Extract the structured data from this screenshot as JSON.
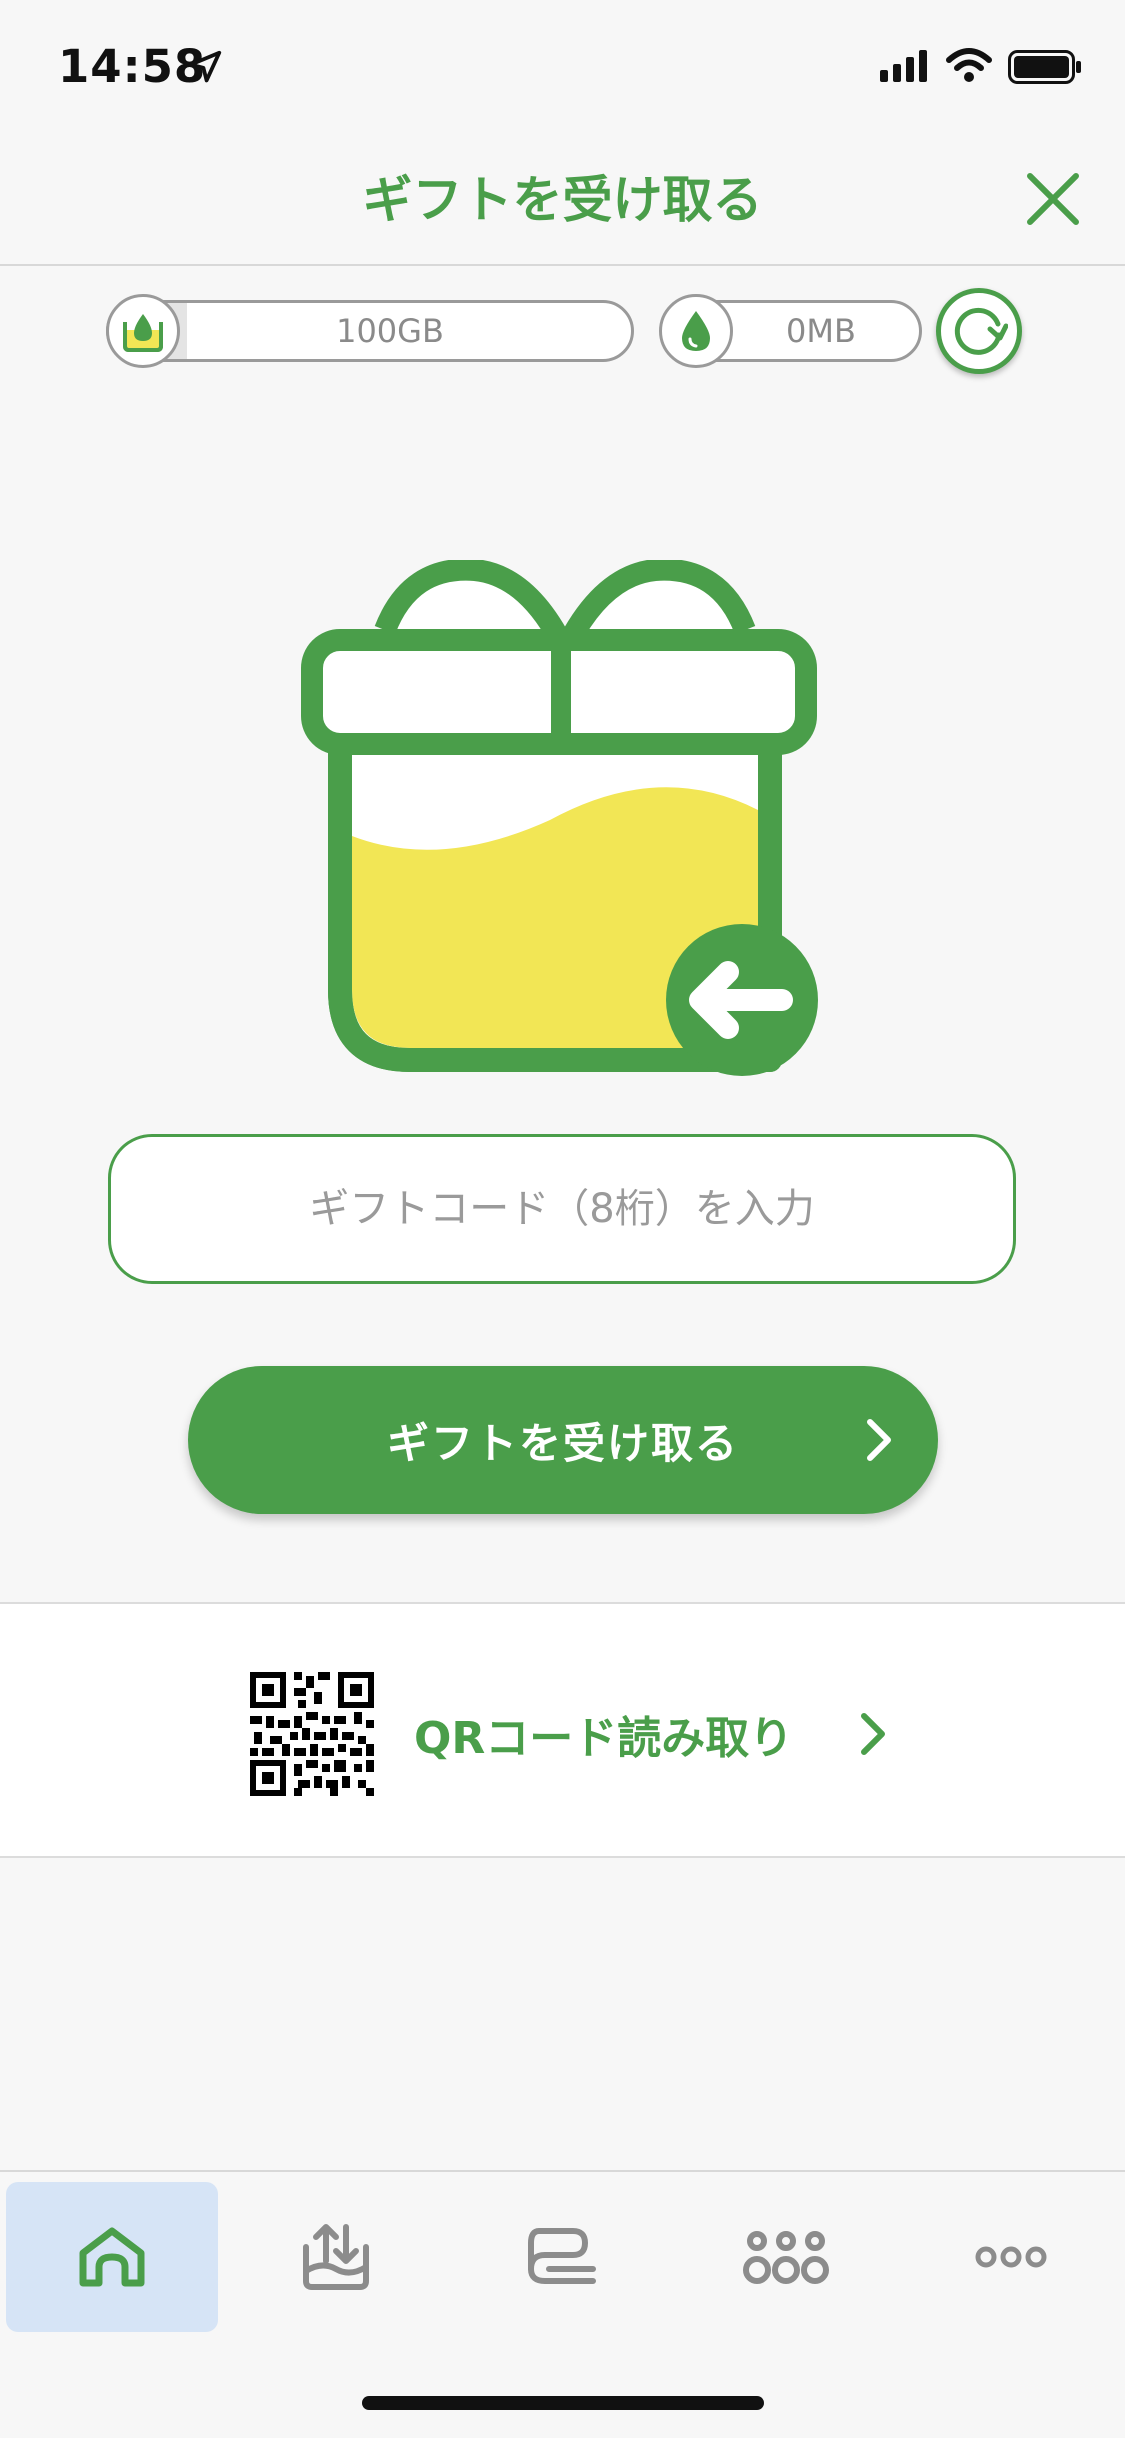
{
  "status_bar": {
    "time": "14:58",
    "icons": [
      "location-arrow-icon",
      "signal-icon",
      "wifi-icon",
      "battery-icon"
    ]
  },
  "header": {
    "title": "ギフトを受け取る",
    "close_icon": "close-icon"
  },
  "data_summary": {
    "balance": {
      "value": "100GB",
      "fill_fraction": 0.15,
      "icon": "data-tank-icon"
    },
    "usage": {
      "value": "0MB",
      "icon": "drop-icon"
    },
    "refresh_icon": "refresh-icon"
  },
  "gift_form": {
    "code_placeholder": "ギフトコード（8桁）を入力",
    "code_value": "",
    "submit_label": "ギフトを受け取る"
  },
  "qr_row": {
    "label": "QRコード読み取り",
    "icon": "qr-code-icon"
  },
  "tab_bar": {
    "tabs": [
      {
        "icon": "home-icon",
        "selected": true
      },
      {
        "icon": "transfer-icon",
        "selected": false
      },
      {
        "icon": "chat-icon",
        "selected": false
      },
      {
        "icon": "share-icon",
        "selected": false
      },
      {
        "icon": "more-icon",
        "selected": false
      }
    ]
  },
  "colors": {
    "accent": "#4a9e4a",
    "gift_fill": "#f2e655",
    "selected_tab_bg": "#d6e4f6",
    "page_bg": "#f7f7f7"
  }
}
